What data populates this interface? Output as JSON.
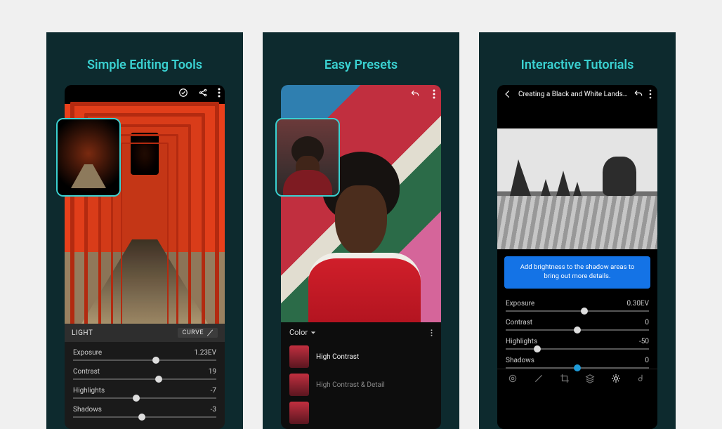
{
  "panels": {
    "editing": {
      "title": "Simple Editing Tools",
      "section_label": "LIGHT",
      "curve_label": "CURVE",
      "sliders": [
        {
          "label": "Exposure",
          "value": "1.23EV",
          "pos": 58
        },
        {
          "label": "Contrast",
          "value": "19",
          "pos": 60
        },
        {
          "label": "Highlights",
          "value": "-7",
          "pos": 44
        },
        {
          "label": "Shadows",
          "value": "-3",
          "pos": 48
        }
      ]
    },
    "presets": {
      "title": "Easy Presets",
      "category": "Color",
      "items": [
        {
          "name": "High Contrast"
        },
        {
          "name": "High Contrast & Detail"
        },
        {
          "name": ""
        }
      ]
    },
    "tutorials": {
      "title": "Interactive Tutorials",
      "header_title": "Creating a Black and White Landsc…",
      "tip": "Add brightness to the shadow areas to bring out more details.",
      "sliders": [
        {
          "label": "Exposure",
          "value": "0.30EV",
          "pos": 55,
          "sel": false
        },
        {
          "label": "Contrast",
          "value": "0",
          "pos": 50,
          "sel": false
        },
        {
          "label": "Highlights",
          "value": "-50",
          "pos": 22,
          "sel": false
        },
        {
          "label": "Shadows",
          "value": "0",
          "pos": 50,
          "sel": true
        }
      ]
    }
  }
}
